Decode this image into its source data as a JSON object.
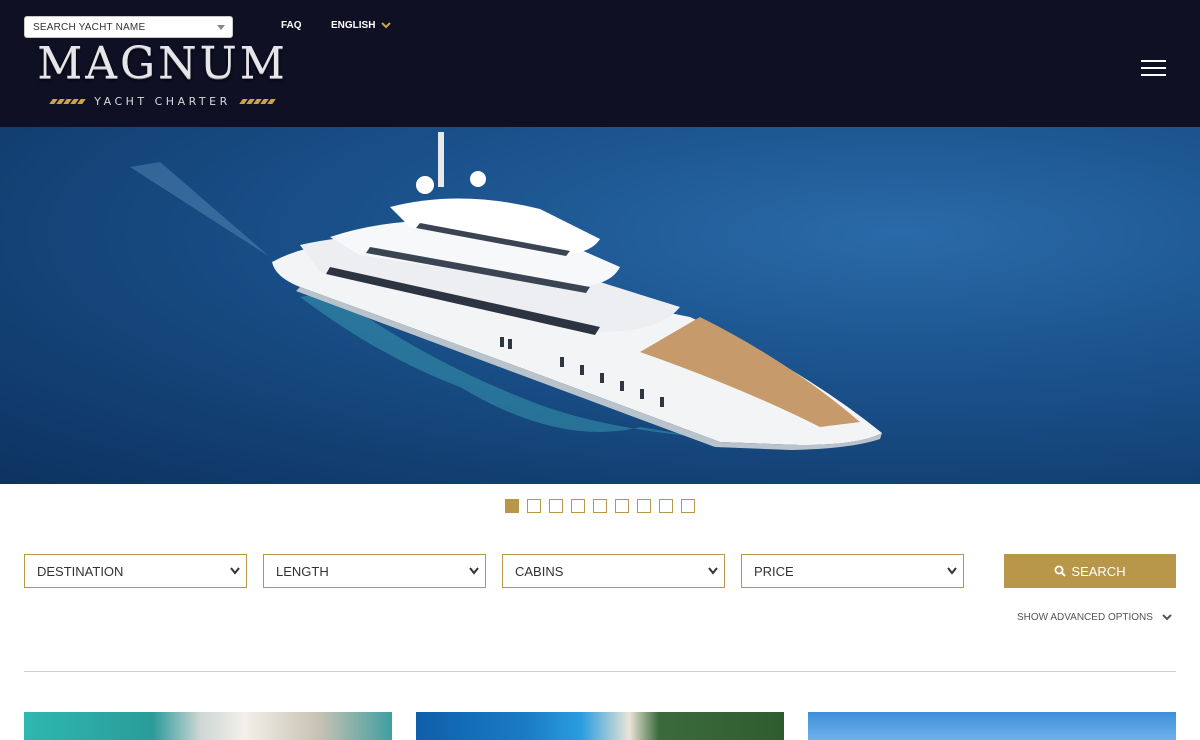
{
  "header": {
    "yacht_search_placeholder": "SEARCH YACHT NAME",
    "faq_label": "FAQ",
    "language_label": "ENGLISH",
    "logo_text": "MAGNUM",
    "logo_subtext": "YACHT CHARTER",
    "menu_icon": "hamburger-icon"
  },
  "hero": {
    "carousel_total": 9,
    "carousel_active_index": 0
  },
  "filters": {
    "destination": "DESTINATION",
    "length": "LENGTH",
    "cabins": "CABINS",
    "price": "PRICE",
    "search_label": "SEARCH",
    "advanced_label": "SHOW ADVANCED OPTIONS"
  },
  "colors": {
    "header_bg": "#0f1024",
    "accent_gold": "#b8964a",
    "logo_stripe_gold": "#c9a645"
  }
}
